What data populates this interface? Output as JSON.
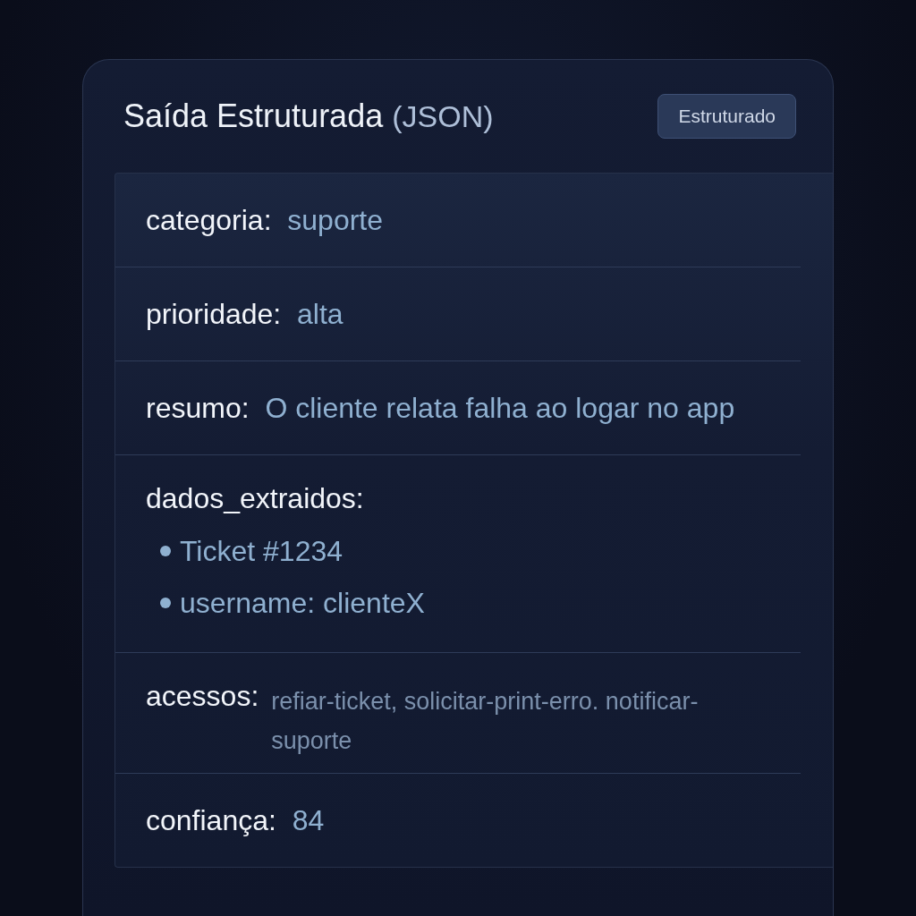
{
  "card": {
    "title": "Saída Estruturada",
    "title_suffix": "(JSON)",
    "badge": "Estruturado"
  },
  "fields": [
    {
      "kind": "inline",
      "label": "categoria:",
      "value": "suporte"
    },
    {
      "kind": "inline",
      "label": "prioridade:",
      "value": "alta"
    },
    {
      "kind": "inline",
      "label": "resumo:",
      "value": "O cliente relata falha ao logar no app"
    },
    {
      "kind": "list",
      "label": "dados_extraidos:",
      "items": [
        "Ticket #1234",
        "username: clienteX"
      ]
    },
    {
      "kind": "hanging",
      "label": "acessos:",
      "value": "refiar-ticket, solicitar-print-erro. notificar-suporte"
    },
    {
      "kind": "inline",
      "label": "confiança:",
      "value": "84"
    }
  ]
}
